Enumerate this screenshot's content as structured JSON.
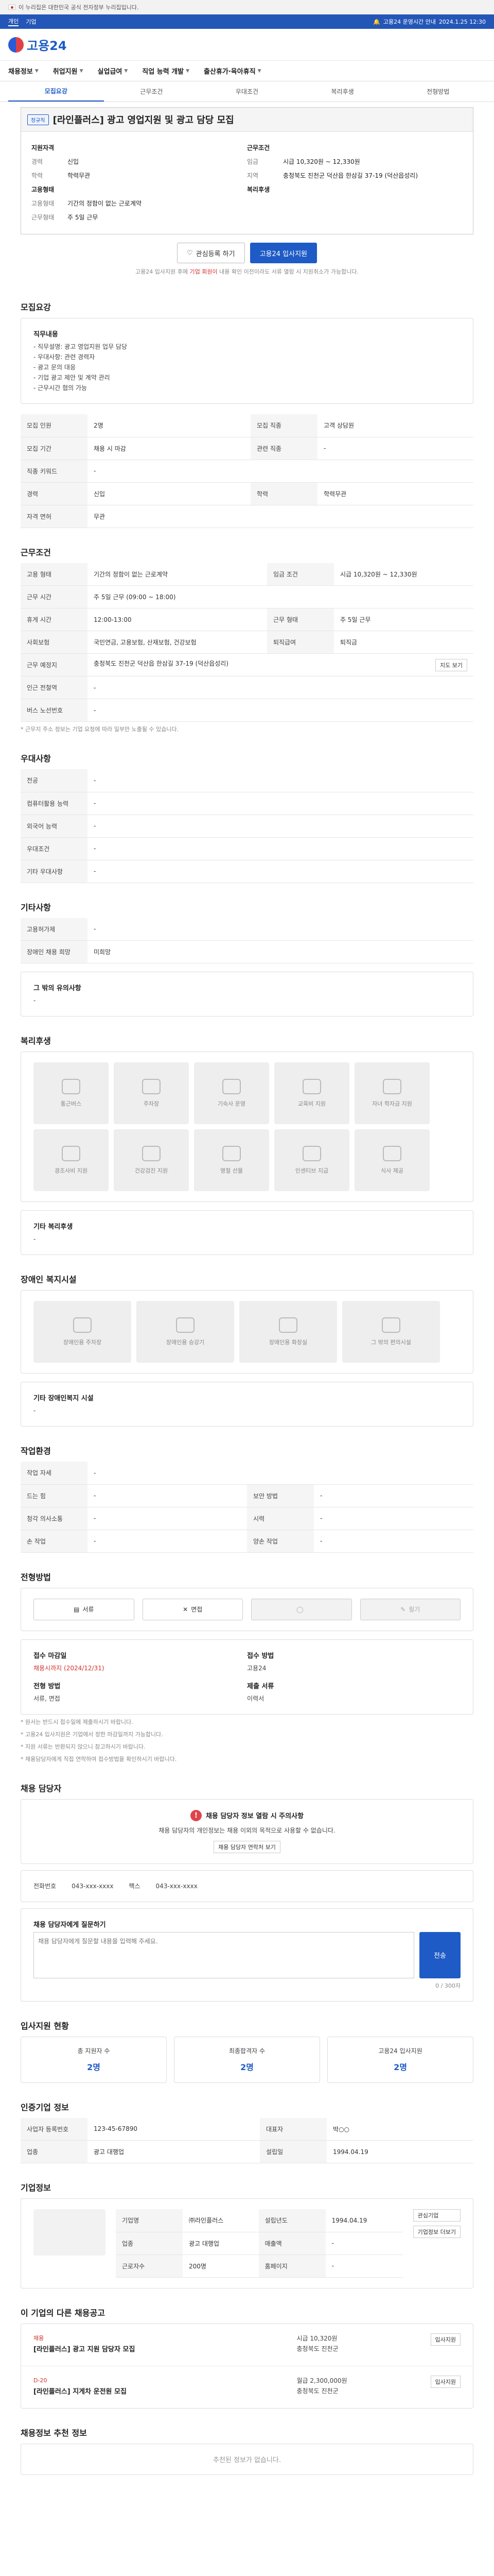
{
  "gov": "이 누리집은 대한민국 공식 전자정부 누리집입니다.",
  "topbar": {
    "tabs": [
      "개인",
      "기업"
    ],
    "notice": "고용24 운영시간 안내",
    "time": "2024.1.25 12:30"
  },
  "logo": "고용24",
  "gnb": [
    "채용정보",
    "취업지원",
    "실업급여",
    "직업 능력 개발",
    "출산휴가·육아휴직"
  ],
  "tabs": [
    "모집요강",
    "근무조건",
    "우대조건",
    "복리후생",
    "전형방법"
  ],
  "title": {
    "badge": "정규직",
    "text": "[라인플러스] 광고 영업지원 및 광고 담당 모집"
  },
  "summary": {
    "left_head": "지원자격",
    "left": [
      {
        "k": "경력",
        "v": "신입"
      },
      {
        "k": "학력",
        "v": "학력무관"
      }
    ],
    "right_head": "근무조건",
    "right": [
      {
        "k": "임금",
        "v": "시급 10,320원 ~ 12,330원"
      },
      {
        "k": "지역",
        "v": "충청북도 진천군 덕산읍 한삼길 37-19 (덕산읍성리)"
      }
    ],
    "left2_head": "고용형태",
    "left2": [
      {
        "k": "고용형태",
        "v": "기간의 정함이 없는 근로계약"
      },
      {
        "k": "근무형태",
        "v": "주 5일 근무"
      }
    ],
    "right2_head": "복리후생",
    "right2": []
  },
  "cta": {
    "save": "관심등록 하기",
    "apply": "고용24 입사지원",
    "note_pre": "고용24 입사지원 후에 ",
    "note_red": "기업 회원이 ",
    "note_post": "내용 확인 이전이라도 서류 열람 시 지원취소가 가능합니다."
  },
  "recruit": {
    "heading": "모집요강",
    "duty_head": "직무내용",
    "duty_lines": [
      "- 직무설명: 광고 영업지원 업무 담당",
      "- 우대사항: 관련 경력자",
      "- 광고 문의 대응",
      "- 기업 광고 제안 및 계약 관리",
      "- 근무시간 협의 가능"
    ],
    "rows": [
      [
        {
          "k": "모집 인원",
          "v": "2명"
        },
        {
          "k": "모집 직종",
          "v": "고객 상담원"
        }
      ],
      [
        {
          "k": "모집 기간",
          "v": "채용 시 마감"
        },
        {
          "k": "관련 직종",
          "v": "-"
        }
      ],
      [
        {
          "k": "직종 키워드",
          "v": "-"
        },
        {
          "k": "",
          "v": ""
        }
      ],
      [
        {
          "k": "경력",
          "v": "신입"
        },
        {
          "k": "학력",
          "v": "학력무관"
        }
      ],
      [
        {
          "k": "자격 면허",
          "v": "무관"
        },
        {
          "k": "",
          "v": ""
        }
      ]
    ]
  },
  "work": {
    "heading": "근무조건",
    "rows": [
      [
        {
          "k": "고용 형태",
          "v": "기간의 정함이 없는 근로계약"
        },
        {
          "k": "임금 조건",
          "v": "시급 10,320원 ~ 12,330원"
        }
      ],
      [
        {
          "k": "근무 시간",
          "v": "주 5일 근무 (09:00 ~ 18:00)"
        },
        {
          "k": "",
          "v": ""
        }
      ],
      [
        {
          "k": "휴게 시간",
          "v": "12:00-13:00"
        },
        {
          "k": "근무 형태",
          "v": "주 5일 근무"
        }
      ],
      [
        {
          "k": "사회보험",
          "v": "국민연금, 고용보험, 산재보험, 건강보험"
        },
        {
          "k": "퇴직급여",
          "v": "퇴직금"
        }
      ],
      [
        {
          "k": "근무 예정지",
          "v": "충청북도 진천군 덕산읍 한삼길 37-19 (덕산읍성리)"
        },
        {
          "k": "",
          "v": ""
        }
      ],
      [
        {
          "k": "인근 전철역",
          "v": "-"
        },
        {
          "k": "",
          "v": ""
        }
      ],
      [
        {
          "k": "버스 노선번호",
          "v": "-"
        },
        {
          "k": "",
          "v": ""
        }
      ]
    ],
    "map_btn": "지도 보기",
    "note": "* 근무지 주소 정보는 기업 요청에 따라 일부만 노출될 수 있습니다."
  },
  "pref": {
    "heading": "우대사항",
    "rows": [
      {
        "k": "전공",
        "v": "-"
      },
      {
        "k": "컴퓨터활용 능력",
        "v": "-"
      },
      {
        "k": "외국어 능력",
        "v": "-"
      },
      {
        "k": "우대조건",
        "v": "-"
      },
      {
        "k": "기타 우대사항",
        "v": "-"
      }
    ]
  },
  "etc": {
    "heading": "기타사항",
    "rows": [
      {
        "k": "고용허가제",
        "v": "-"
      },
      {
        "k": "장애인 채용 희망",
        "v": "미희망"
      }
    ],
    "sub": "그 밖의 유의사항",
    "val": "-"
  },
  "welfare": {
    "heading": "복리후생",
    "tiles": [
      "통근버스",
      "주차장",
      "기숙사 운영",
      "교육비 지원",
      "자녀 학자금 지원",
      "경조사비 지원",
      "건강검진 지원",
      "명절 선물",
      "인센티브 지급",
      "식사 제공"
    ],
    "etc_head": "기타 복리후생",
    "etc_val": "-"
  },
  "disab": {
    "heading": "장애인 복지시설",
    "tiles": [
      "장애인용 주차장",
      "장애인용 승강기",
      "장애인용 화장실",
      "그 밖의 편의시설"
    ],
    "etc_head": "기타 장애인복지 시설",
    "etc_val": "-"
  },
  "worksite": {
    "heading": "작업환경",
    "rows": [
      [
        {
          "k": "작업 자세",
          "v": "-"
        },
        {
          "k": "",
          "v": ""
        }
      ],
      [
        {
          "k": "드는 힘",
          "v": "-"
        },
        {
          "k": "보안 방법",
          "v": "-"
        }
      ],
      [
        {
          "k": "청각 의사소통",
          "v": "-"
        },
        {
          "k": "시력",
          "v": "-"
        }
      ],
      [
        {
          "k": "손 작업",
          "v": "-"
        },
        {
          "k": "양손 작업",
          "v": "-"
        }
      ]
    ]
  },
  "select": {
    "heading": "전형방법",
    "steps": [
      "서류",
      "면접",
      "",
      "필기"
    ],
    "left": [
      {
        "k": "접수 마감일",
        "v": "채용시까지 (2024/12/31)"
      },
      {
        "k": "전형 방법",
        "v": "서류, 면접"
      }
    ],
    "right": [
      {
        "k": "접수 방법",
        "v": "고용24"
      },
      {
        "k": "제출 서류",
        "v": "이력서"
      }
    ],
    "notes": [
      "* 원서는 반드시 접수일에 제출하시기 바랍니다.",
      "* 고용24 입사지원은 기업에서 정한 마감일까지 가능합니다.",
      "* 지원 서류는 반환되지 않으니 참고하시기 바랍니다.",
      "* 채용담당자에게 직접 연락하여 접수방법을 확인하시기 바랍니다."
    ]
  },
  "contact": {
    "heading": "채용 담당자",
    "warn_title": "채용 담당자 정보 열람 시 주의사항",
    "warn": "채용 담당자의 개인정보는 채용 이외의 목적으로 사용할 수 없습니다.",
    "btn": "채용 담당자 연락처 보기",
    "phone_k": "전화번호",
    "phone": "043-xxx-xxxx",
    "fax_k": "팩스",
    "fax": "043-xxx-xxxx",
    "q_head": "채용 담당자에게 질문하기",
    "q_placeholder": "채용 담당자에게 질문할 내용을 입력해 주세요.",
    "q_count": "0 / 300자",
    "q_btn": "전송"
  },
  "status": {
    "heading": "입사지원 현황",
    "cards": [
      {
        "l": "총 지원자 수",
        "n": "2명"
      },
      {
        "l": "최종합격자 수",
        "n": "2명"
      },
      {
        "l": "고용24 입사지원",
        "n": "2명"
      }
    ]
  },
  "company": {
    "heading": "인증기업 정보",
    "rows": [
      [
        {
          "k": "사업자 등록번호",
          "v": "123-45-67890"
        },
        {
          "k": "대표자",
          "v": "박○○"
        }
      ],
      [
        {
          "k": "업종",
          "v": "광고 대행업"
        },
        {
          "k": "설립일",
          "v": "1994.04.19"
        }
      ]
    ]
  },
  "biz": {
    "heading": "기업정보",
    "btn_follow": "관심기업",
    "btn_more": "기업정보 더보기",
    "rows": [
      [
        {
          "k": "기업명",
          "v": "㈜라인플러스"
        },
        {
          "k": "설립년도",
          "v": "1994.04.19"
        }
      ],
      [
        {
          "k": "업종",
          "v": "광고 대행업"
        },
        {
          "k": "매출액",
          "v": "-"
        }
      ],
      [
        {
          "k": "근로자수",
          "v": "200명"
        },
        {
          "k": "홈페이지",
          "v": "-"
        }
      ]
    ]
  },
  "others": {
    "heading": "이 기업의 다른 채용공고",
    "jobs": [
      {
        "badge": "채용",
        "title": "[라인플러스] 광고 지원 담당자 모집",
        "wage": "시급 10,320원",
        "loc": "충청북도 진천군",
        "btn": "입사지원"
      },
      {
        "badge": "D-20",
        "title": "[라인플러스] 지게차 운전원 모집",
        "wage": "월급 2,300,000원",
        "loc": "충청북도 진천군",
        "btn": "입사지원"
      }
    ]
  },
  "rec": {
    "heading": "채용정보 추천 정보",
    "empty": "추천된 정보가 없습니다."
  }
}
